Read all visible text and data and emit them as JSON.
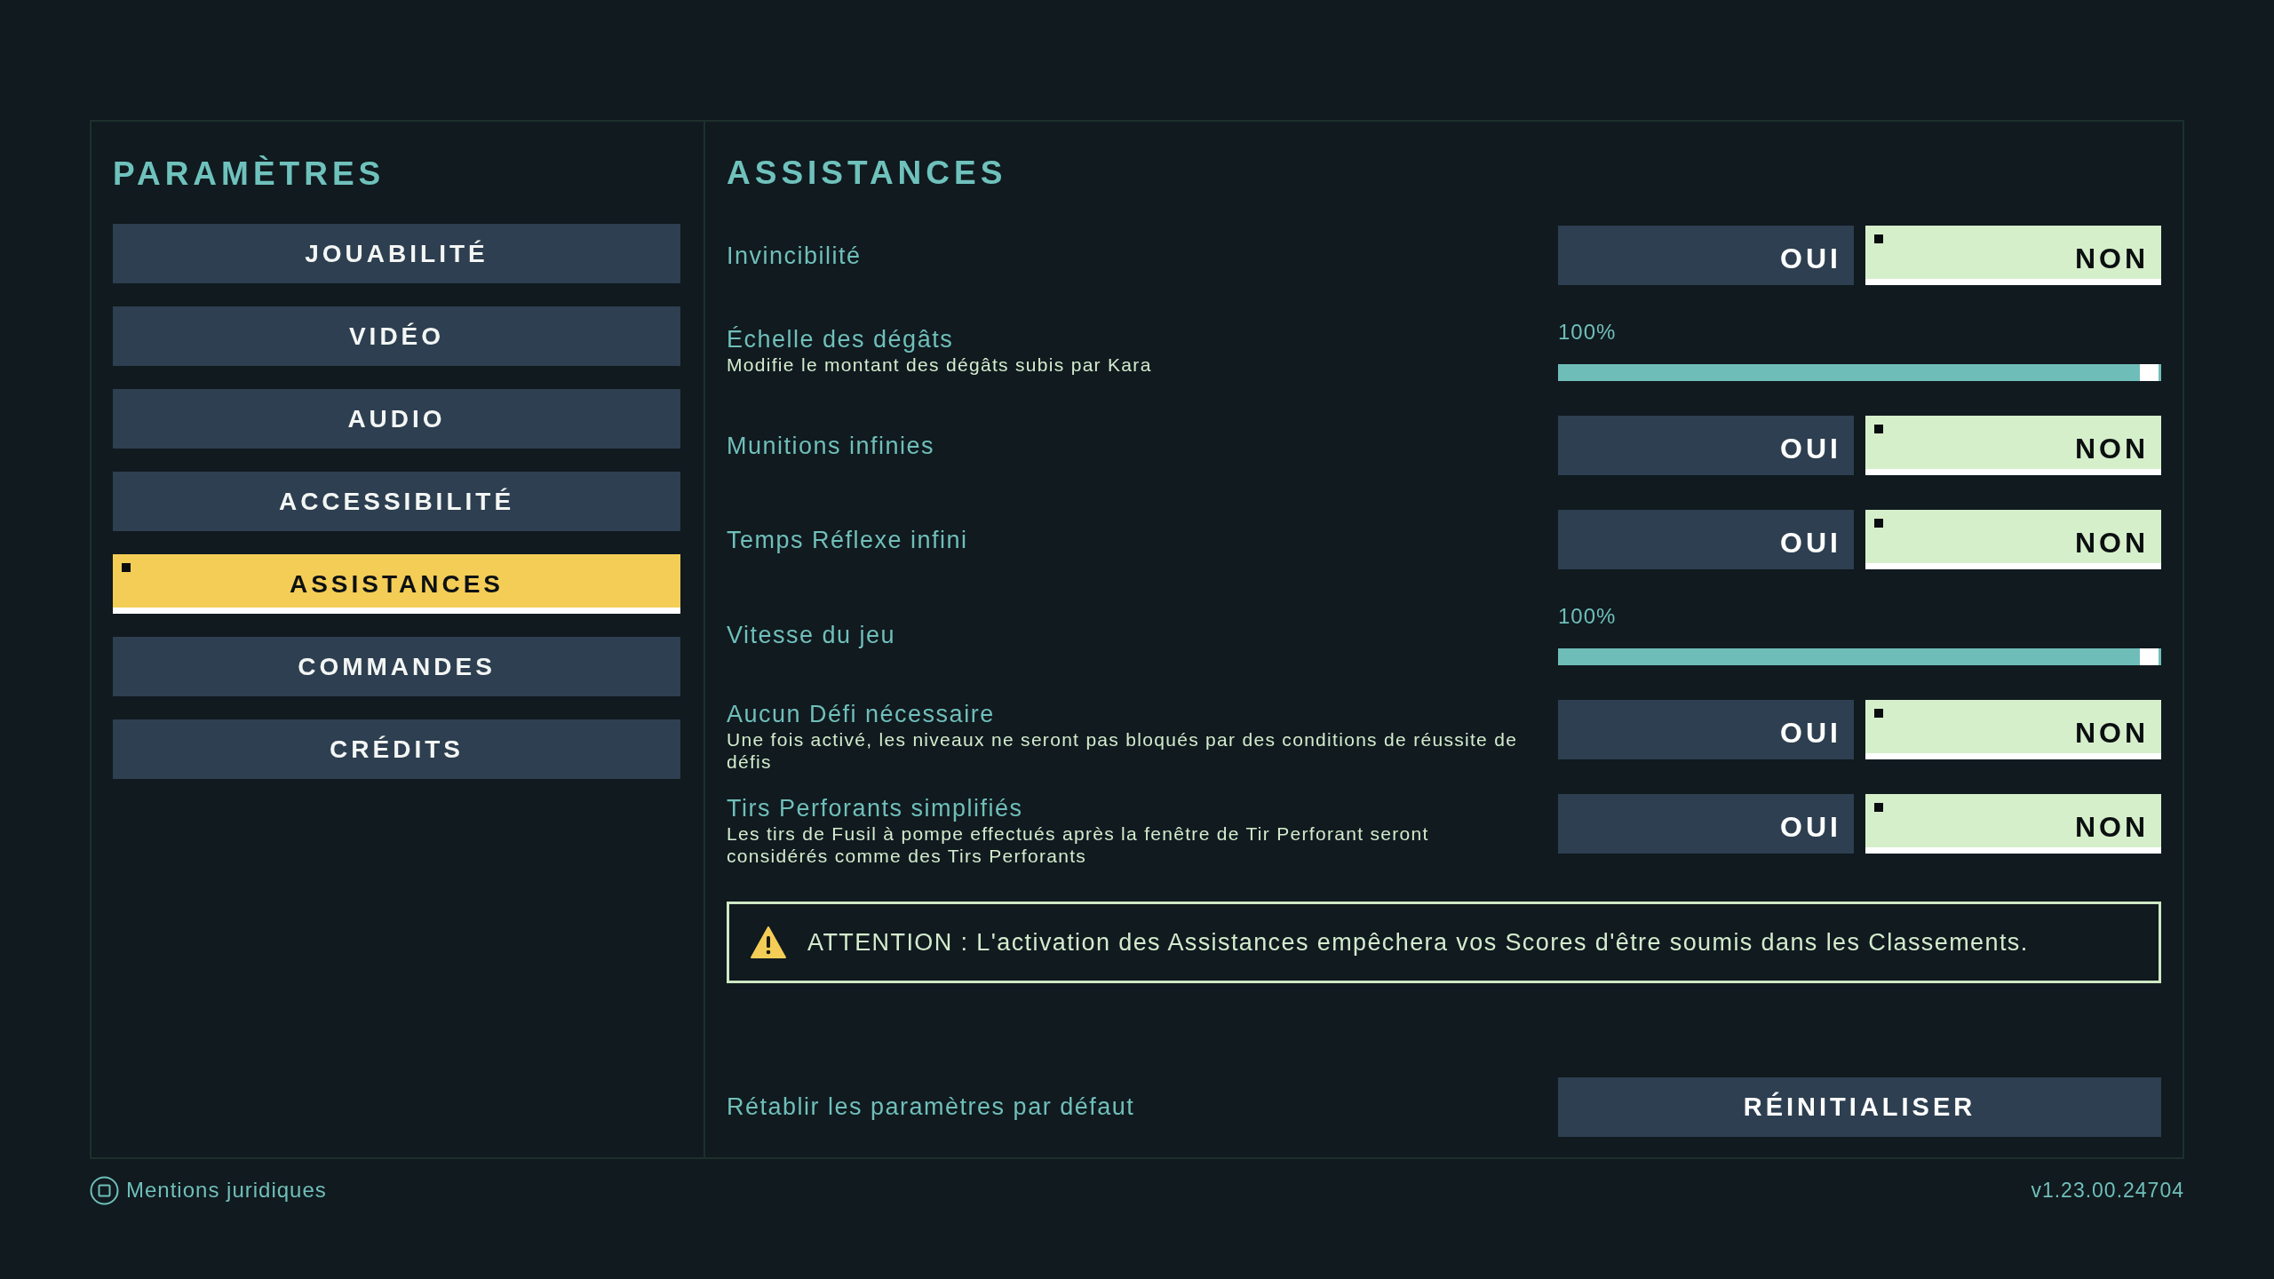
{
  "sidebar": {
    "title": "PARAMÈTRES",
    "items": [
      {
        "label": "JOUABILITÉ",
        "selected": false
      },
      {
        "label": "VIDÉO",
        "selected": false
      },
      {
        "label": "AUDIO",
        "selected": false
      },
      {
        "label": "ACCESSIBILITÉ",
        "selected": false
      },
      {
        "label": "ASSISTANCES",
        "selected": true
      },
      {
        "label": "COMMANDES",
        "selected": false
      },
      {
        "label": "CRÉDITS",
        "selected": false
      }
    ]
  },
  "panel": {
    "title": "ASSISTANCES",
    "rows": [
      {
        "kind": "toggle",
        "label": "Invincibilité",
        "options": [
          {
            "label": "OUI",
            "selected": false
          },
          {
            "label": "NON",
            "selected": true
          }
        ]
      },
      {
        "kind": "slider",
        "label": "Échelle des dégâts",
        "description": "Modifie le montant des dégâts subis par Kara",
        "reading": "100%",
        "level": 1
      },
      {
        "kind": "toggle",
        "label": "Munitions infinies",
        "options": [
          {
            "label": "OUI",
            "selected": false
          },
          {
            "label": "NON",
            "selected": true
          }
        ]
      },
      {
        "kind": "toggle",
        "label": "Temps Réflexe infini",
        "options": [
          {
            "label": "OUI",
            "selected": false
          },
          {
            "label": "NON",
            "selected": true
          }
        ]
      },
      {
        "kind": "slider",
        "label": "Vitesse du jeu",
        "reading": "100%",
        "level": 1
      },
      {
        "kind": "toggle",
        "label": "Aucun Défi nécessaire",
        "description": "Une fois activé, les niveaux ne seront pas bloqués par des conditions de réussite de défis",
        "options": [
          {
            "label": "OUI",
            "selected": false
          },
          {
            "label": "NON",
            "selected": true
          }
        ]
      },
      {
        "kind": "toggle",
        "label": "Tirs Perforants simplifiés",
        "description": "Les tirs de Fusil à pompe effectués après la fenêtre de Tir Perforant seront considérés comme des Tirs Perforants",
        "options": [
          {
            "label": "OUI",
            "selected": false
          },
          {
            "label": "NON",
            "selected": true
          }
        ]
      }
    ],
    "warning": {
      "text": "ATTENTION : L'activation des Assistances empêchera vos Scores d'être soumis dans les Classements."
    },
    "reset": {
      "label": "Rétablir les paramètres par défaut",
      "button": "RÉINITIALISER"
    }
  },
  "footer": {
    "legal_link": "Mentions juridiques",
    "version": "v1.23.00.24704"
  }
}
